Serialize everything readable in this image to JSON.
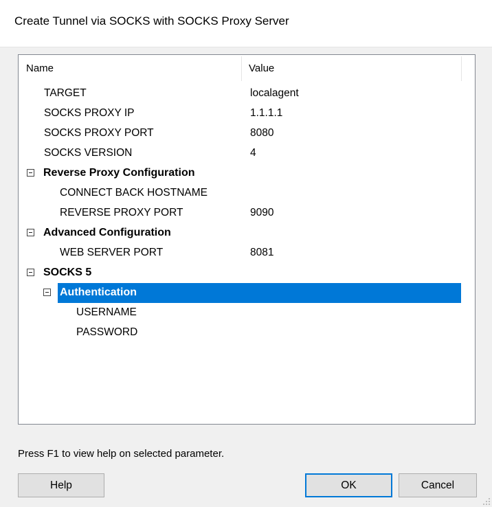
{
  "window": {
    "title": "Create Tunnel via SOCKS with SOCKS Proxy Server"
  },
  "tree": {
    "columns": {
      "name": "Name",
      "value": "Value"
    },
    "rows": [
      {
        "name": "TARGET",
        "value": "localagent"
      },
      {
        "name": "SOCKS PROXY IP",
        "value": "1.1.1.1"
      },
      {
        "name": "SOCKS PROXY PORT",
        "value": "8080"
      },
      {
        "name": "SOCKS VERSION",
        "value": "4"
      },
      {
        "name": "Reverse Proxy Configuration",
        "value": ""
      },
      {
        "name": "CONNECT BACK HOSTNAME",
        "value": ""
      },
      {
        "name": "REVERSE PROXY PORT",
        "value": "9090"
      },
      {
        "name": "Advanced Configuration",
        "value": ""
      },
      {
        "name": "WEB SERVER PORT",
        "value": "8081"
      },
      {
        "name": "SOCKS 5",
        "value": ""
      },
      {
        "name": "Authentication",
        "value": ""
      },
      {
        "name": "USERNAME",
        "value": ""
      },
      {
        "name": "PASSWORD",
        "value": ""
      }
    ]
  },
  "footer": {
    "help_text": "Press F1 to view help on selected parameter.",
    "help_label": "Help",
    "ok_label": "OK",
    "cancel_label": "Cancel"
  },
  "colors": {
    "selection": "#0078d7",
    "default_button_border": "#0078d7"
  }
}
